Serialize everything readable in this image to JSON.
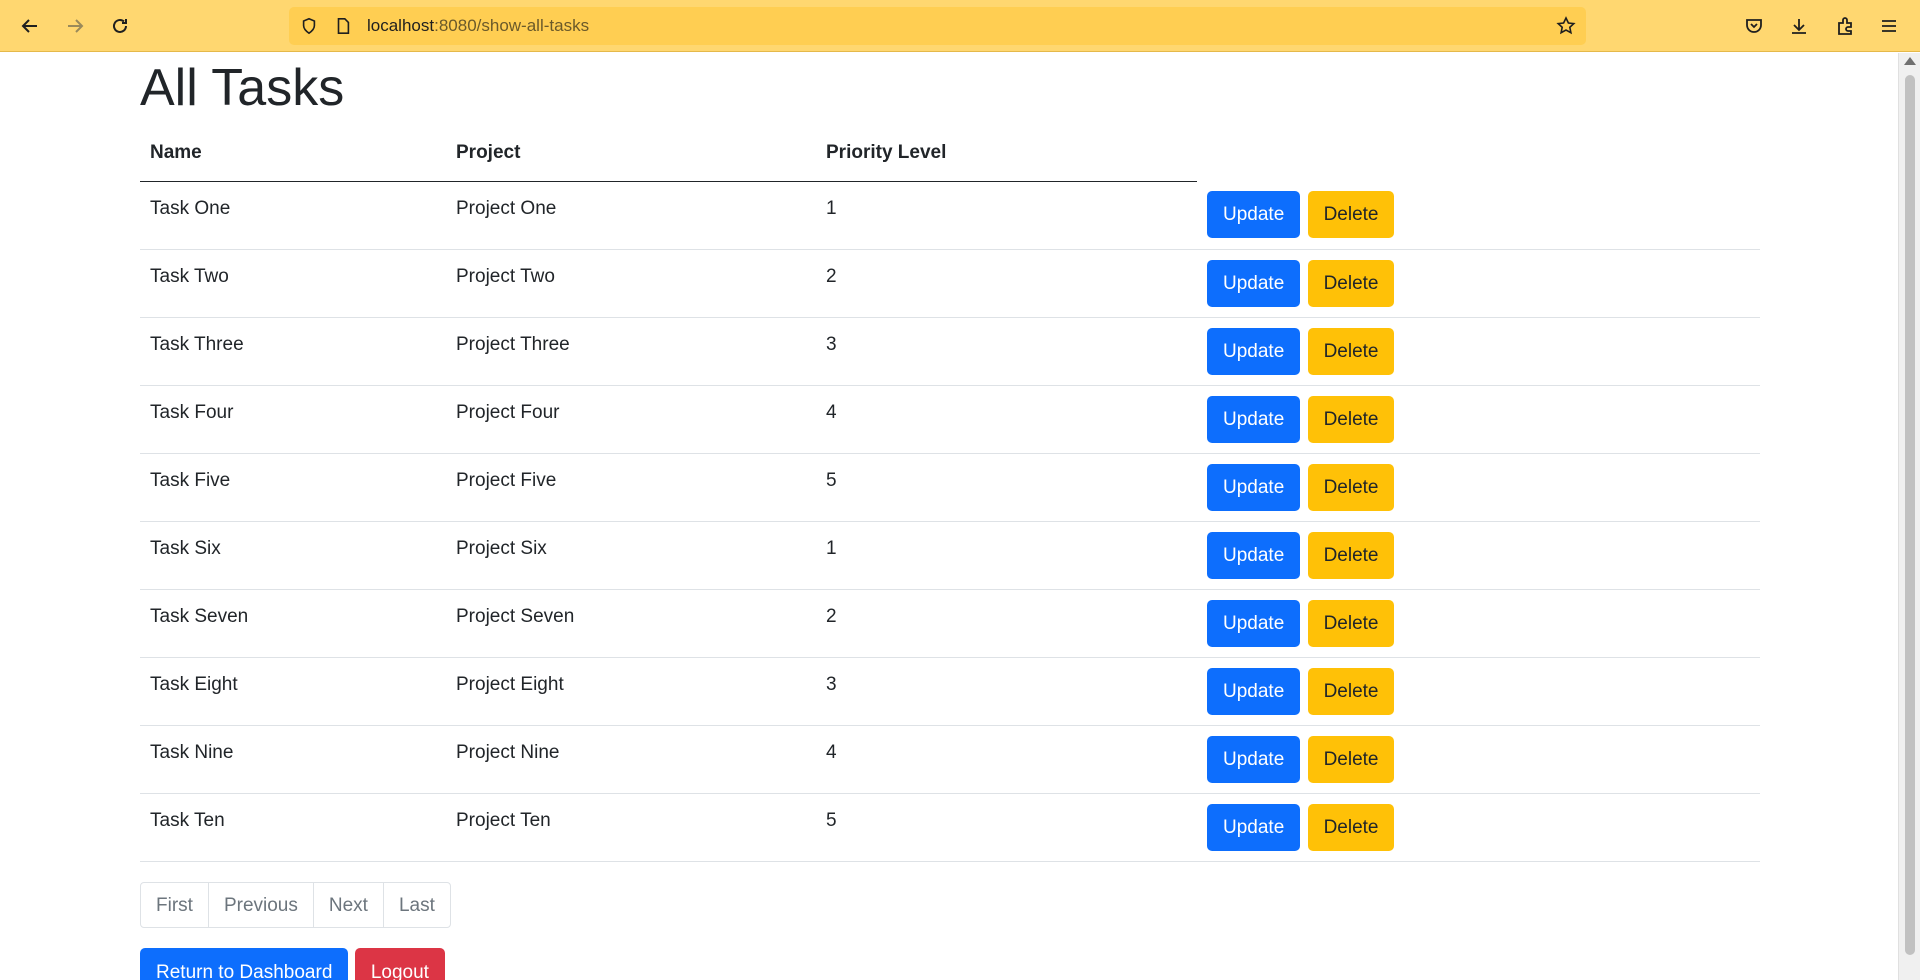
{
  "browser": {
    "url_host": "localhost",
    "url_rest": ":8080/show-all-tasks",
    "icons": [
      "back-arrow-icon",
      "forward-arrow-icon",
      "reload-icon",
      "shield-icon",
      "page-icon",
      "star-icon",
      "pocket-icon",
      "download-icon",
      "extensions-icon",
      "menu-icon"
    ]
  },
  "page": {
    "title": "All Tasks"
  },
  "table": {
    "headers": {
      "name": "Name",
      "project": "Project",
      "priority": "Priority Level"
    },
    "update_label": "Update",
    "delete_label": "Delete",
    "rows": [
      {
        "name": "Task One",
        "project": "Project One",
        "priority": "1"
      },
      {
        "name": "Task Two",
        "project": "Project Two",
        "priority": "2"
      },
      {
        "name": "Task Three",
        "project": "Project Three",
        "priority": "3"
      },
      {
        "name": "Task Four",
        "project": "Project Four",
        "priority": "4"
      },
      {
        "name": "Task Five",
        "project": "Project Five",
        "priority": "5"
      },
      {
        "name": "Task Six",
        "project": "Project Six",
        "priority": "1"
      },
      {
        "name": "Task Seven",
        "project": "Project Seven",
        "priority": "2"
      },
      {
        "name": "Task Eight",
        "project": "Project Eight",
        "priority": "3"
      },
      {
        "name": "Task Nine",
        "project": "Project Nine",
        "priority": "4"
      },
      {
        "name": "Task Ten",
        "project": "Project Ten",
        "priority": "5"
      }
    ]
  },
  "pagination": {
    "first": "First",
    "previous": "Previous",
    "next": "Next",
    "last": "Last"
  },
  "actions": {
    "dashboard": "Return to Dashboard",
    "logout": "Logout"
  },
  "colors": {
    "primary": "#0d6efd",
    "warning": "#ffc107",
    "danger": "#dc3545",
    "chrome": "#ffd770"
  }
}
